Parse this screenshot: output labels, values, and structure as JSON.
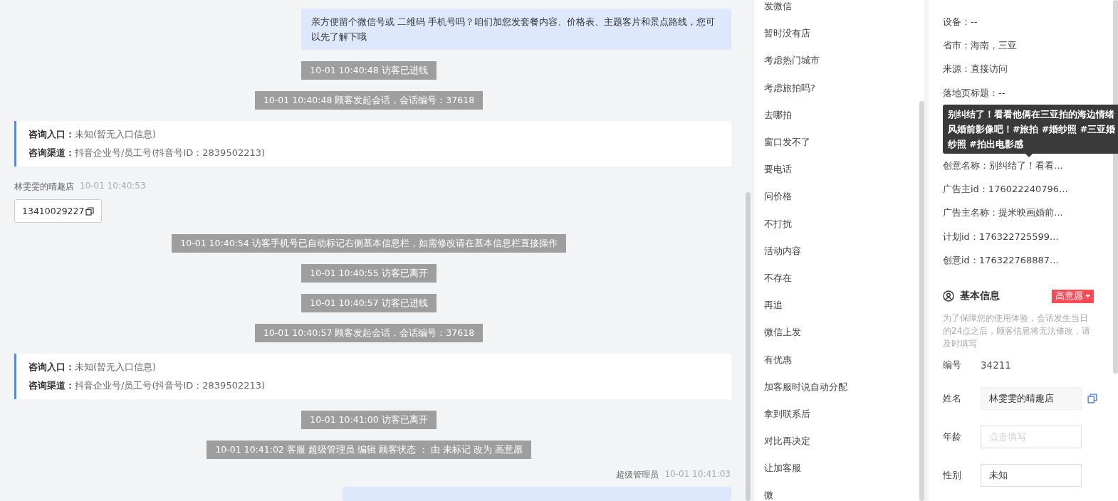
{
  "chat": {
    "messages": [
      {
        "kind": "outgoing",
        "text": "亲方便留个微信号或 二维码 手机号吗？咱们加您发套餐内容、价格表、主题客片和景点路线，您可以先了解下哦"
      },
      {
        "kind": "notice",
        "text": "10-01 10:40:48 访客已进线"
      },
      {
        "kind": "notice",
        "text": "10-01 10:40:48 顾客发起会话，会话编号：37618"
      },
      {
        "kind": "entry",
        "lines": [
          {
            "label": "咨询入口：",
            "value": "未知(暂无入口信息)"
          },
          {
            "label": "咨询渠道：",
            "value": "抖音企业号/员工号(抖音号ID：2839502213)"
          }
        ]
      },
      {
        "kind": "incoming",
        "sender": "林雯雯的晴趣店",
        "time": "10-01 10:40:53",
        "text": "13410029227"
      },
      {
        "kind": "notice",
        "text": "10-01 10:40:54 访客手机号已自动标记右侧基本信息栏，如需修改请在基本信息栏直接操作"
      },
      {
        "kind": "notice",
        "text": "10-01 10:40:55 访客已离开"
      },
      {
        "kind": "notice",
        "text": "10-01 10:40:57 访客已进线"
      },
      {
        "kind": "notice",
        "text": "10-01 10:40:57 顾客发起会话，会话编号：37618"
      },
      {
        "kind": "entry",
        "lines": [
          {
            "label": "咨询入口：",
            "value": "未知(暂无入口信息)"
          },
          {
            "label": "咨询渠道：",
            "value": "抖音企业号/员工号(抖音号ID：2839502213)"
          }
        ]
      },
      {
        "kind": "notice",
        "text": "10-01 10:41:00 访客已离开"
      },
      {
        "kind": "notice",
        "text": "10-01 10:41:02 客服 超级管理员 编辑 顾客状态 ： 由 未标记 改为 高意愿"
      },
      {
        "kind": "agent_header",
        "sender": "超级管理员",
        "time": "10-01 10:41:03"
      }
    ]
  },
  "quick_replies": [
    "发微信",
    "暂时没有店",
    "考虑热门城市",
    "考虑旅拍吗?",
    "去哪拍",
    "窗口发不了",
    "要电话",
    "问价格",
    "不打扰",
    "活动内容",
    "不存在",
    "再追",
    "微信上发",
    "有优惠",
    "加客服时说自动分配",
    "拿到联系后",
    "对比再决定",
    "让加客服",
    "微"
  ],
  "details": {
    "rows": [
      {
        "kind": "row",
        "text": "设备：--"
      },
      {
        "kind": "row",
        "text": "省市：海南，三亚"
      },
      {
        "kind": "row",
        "text": "来源：直接访问"
      },
      {
        "kind": "row",
        "text": "落地页标题：--"
      },
      {
        "kind": "tooltip",
        "text": "别纠结了！看看他俩在三亚拍的海边情绪风婚前影像吧！#旅拍 #婚纱照 #三亚婚纱照 #拍出电影感"
      },
      {
        "kind": "row",
        "text": "创意名称：别纠结了！看看..."
      },
      {
        "kind": "row",
        "text": "广告主id：176022240796..."
      },
      {
        "kind": "row",
        "text": "广告主名称：提米映画婚前..."
      },
      {
        "kind": "row",
        "text": "计划id：176322725599..."
      },
      {
        "kind": "row",
        "text": "创意id：176322768887..."
      }
    ]
  },
  "basic_info": {
    "title": "基本信息",
    "intent_tag": "高意愿",
    "note": "为了保障您的使用体验，会话发生当日的24点之后，顾客信息将无法修改，请及时填写",
    "fields": [
      {
        "kind": "static",
        "label": "编号",
        "value": "34211"
      },
      {
        "kind": "filled",
        "label": "姓名",
        "value": "林雯雯的晴趣店",
        "copyable": true
      },
      {
        "kind": "input",
        "label": "年龄",
        "placeholder": "点击填写"
      },
      {
        "kind": "input",
        "label": "性别",
        "value": "未知"
      }
    ]
  }
}
